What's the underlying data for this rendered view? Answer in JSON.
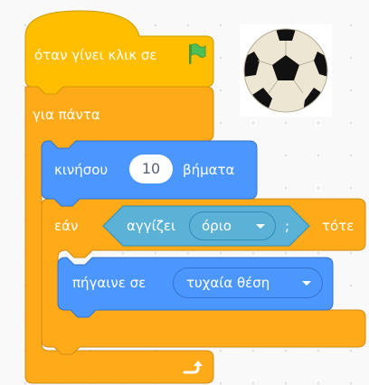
{
  "colors": {
    "events": "#FFBF00",
    "events_border": "#CC9900",
    "control": "#FFAB19",
    "control_border": "#CF8B17",
    "motion": "#4C97FF",
    "motion_border": "#3373CC",
    "sensing": "#5CB1D6",
    "sensing_border": "#2E8EB8",
    "flag": "#4CBF56"
  },
  "hat_block": {
    "label": "όταν γίνει κλικ σε",
    "icon": "green-flag-icon"
  },
  "forever_block": {
    "label": "για πάντα",
    "loop_icon": "loop-arrow-icon"
  },
  "move_block": {
    "label_before": "κινήσου",
    "steps_value": "10",
    "label_after": "βήματα"
  },
  "if_block": {
    "label_if": "εάν",
    "label_then": "τότε"
  },
  "touching_block": {
    "label": "αγγίζει",
    "dropdown_value": "όριο",
    "question_mark": ";"
  },
  "goto_block": {
    "label": "πήγαινε σε",
    "dropdown_value": "τυχαία θέση"
  },
  "sprite_preview": {
    "icon": "soccer-ball-icon"
  }
}
